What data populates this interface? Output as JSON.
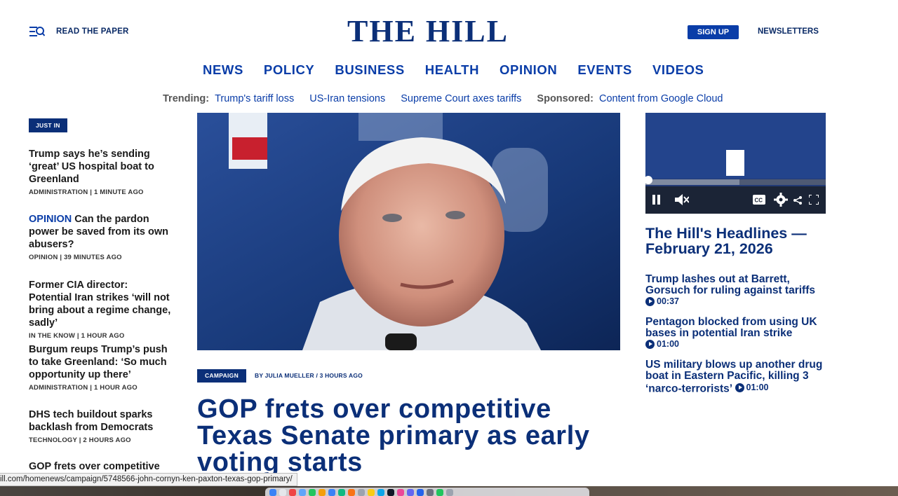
{
  "header": {
    "read_paper": "READ THE PAPER",
    "logo": "THE HILL",
    "sign_up": "SIGN UP",
    "newsletters": "NEWSLETTERS"
  },
  "nav": [
    "NEWS",
    "POLICY",
    "BUSINESS",
    "HEALTH",
    "OPINION",
    "EVENTS",
    "VIDEOS"
  ],
  "trending": {
    "label": "Trending:",
    "links": [
      "Trump's tariff loss",
      "US-Iran tensions",
      "Supreme Court axes tariffs"
    ],
    "sponsored_label": "Sponsored:",
    "sponsored_link": "Content from Google Cloud"
  },
  "left": {
    "just_in": "JUST IN",
    "stories": [
      {
        "tag": "",
        "title": "Trump says he’s sending ‘great’ US hospital boat to Greenland",
        "category": "ADMINISTRATION",
        "time": "1 MINUTE AGO"
      },
      {
        "tag": "OPINION",
        "title": "Can the pardon pow­er be saved from its own abusers?",
        "category": "OPINION",
        "time": "39 MINUTES AGO"
      },
      {
        "tag": "",
        "title": "Former CIA director: Potential Iran strikes ‘will not bring about a regime change, sadly’",
        "category": "IN THE KNOW",
        "time": "1 HOUR AGO"
      },
      {
        "tag": "",
        "title": "Burgum reups Trump’s push to take Greenland: ‘So much opportunity up there’",
        "category": "ADMINISTRATION",
        "time": "1 HOUR AGO"
      },
      {
        "tag": "",
        "title": "DHS tech buildout sparks backlash from Democrats",
        "category": "TECHNOLOGY",
        "time": "2 HOURS AGO"
      },
      {
        "tag": "",
        "title": "GOP frets over competitive",
        "category": "",
        "time": ""
      }
    ]
  },
  "main": {
    "tag": "CAMPAIGN",
    "byline": "BY JULIA MUELLER / 3 HOURS AGO",
    "headline": "GOP frets over competitive Texas Senate primary as early voting starts"
  },
  "video": {
    "title": "The Hill's Headlines — February 21, 2026",
    "items": [
      {
        "title": "Trump lashes out at Barrett, Gorsuch for ruling against tariffs",
        "duration": "00:37"
      },
      {
        "title": "Pentagon blocked from using UK bases in potential Iran strike",
        "duration": "01:00"
      },
      {
        "title": "US military blows up another drug boat in Eastern Pacific, killing 3 ‘narco-terrorists’",
        "duration": "01:00"
      }
    ],
    "progress": 0.52
  },
  "status_url": "ill.com/homenews/campaign/5748566-john-cornyn-ken-paxton-texas-gop-primary/",
  "colors": {
    "brand": "#0b2f78",
    "link": "#0a3da8"
  }
}
